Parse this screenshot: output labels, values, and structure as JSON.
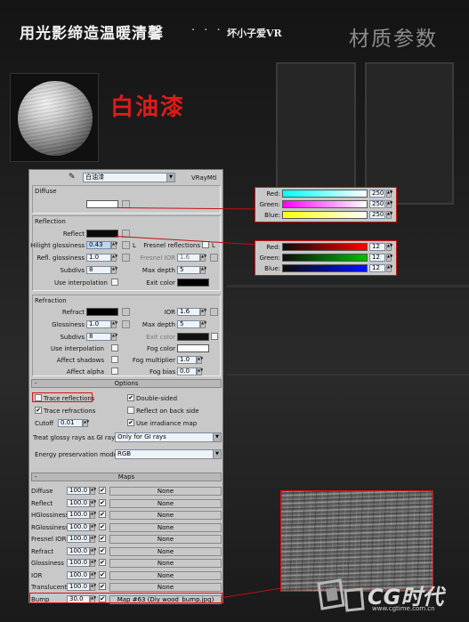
{
  "header": {
    "title": "用光影缔造温暖清馨",
    "dots": "· · ·",
    "author": "坏小子爱VR",
    "section": "材质参数"
  },
  "material_name": "白油漆",
  "panel": {
    "mat_dropdown": "白油漆",
    "mat_type": "VRayMtl",
    "diffuse": {
      "group": "Diffuse",
      "label": "Diffuse",
      "color": "#ffffff"
    },
    "reflection": {
      "group": "Reflection",
      "reflect_label": "Reflect",
      "reflect_color": "#0a0a0a",
      "hilight_label": "Hilight glossiness",
      "hilight_value": "0.43",
      "lock": "L",
      "fresnel_label": "Fresnel reflections",
      "fresnel_lock": "L",
      "refl_gloss_label": "Refl. glossiness",
      "refl_gloss_value": "1.0",
      "fresnel_ior_label": "Fresnel IOR",
      "fresnel_ior_value": "1.6",
      "subdivs_label": "Subdivs",
      "subdivs_value": "8",
      "maxdepth_label": "Max depth",
      "maxdepth_value": "5",
      "use_interp_label": "Use interpolation",
      "exit_label": "Exit color",
      "exit_color": "#000000"
    },
    "refraction": {
      "group": "Refraction",
      "refract_label": "Refract",
      "refract_color": "#000000",
      "ior_label": "IOR",
      "ior_value": "1.6",
      "gloss_label": "Glossiness",
      "gloss_value": "1.0",
      "maxdepth_label": "Max depth",
      "maxdepth_value": "5",
      "subdivs_label": "Subdivs",
      "subdivs_value": "8",
      "exit_label": "Exit color",
      "use_interp_label": "Use interpolation",
      "fog_color_label": "Fog color",
      "fog_color": "#ffffff",
      "affect_shadows_label": "Affect shadows",
      "fog_mult_label": "Fog multiplier",
      "fog_mult_value": "1.0",
      "affect_alpha_label": "Affect alpha",
      "fog_bias_label": "Fog bias",
      "fog_bias_value": "0.0"
    },
    "options": {
      "rollout": "Options",
      "trace_refl": "Trace reflections",
      "double_sided": "Double-sided",
      "trace_refr": "Trace refractions",
      "reflect_back": "Reflect on back side",
      "cutoff_label": "Cutoff",
      "cutoff_value": "0.01",
      "use_irr": "Use irradiance map",
      "glossy_label": "Treat glossy rays as GI rays:",
      "glossy_value": "Only for GI rays",
      "energy_label": "Energy preservation mode:",
      "energy_value": "RGB"
    },
    "maps": {
      "rollout": "Maps",
      "rows": [
        {
          "name": "Diffuse",
          "amount": "100.0",
          "map": "None"
        },
        {
          "name": "Reflect",
          "amount": "100.0",
          "map": "None"
        },
        {
          "name": "HGlossiness",
          "amount": "100.0",
          "map": "None"
        },
        {
          "name": "RGlossiness",
          "amount": "100.0",
          "map": "None"
        },
        {
          "name": "Fresnel IOR",
          "amount": "100.0",
          "map": "None"
        },
        {
          "name": "Refract",
          "amount": "100.0",
          "map": "None"
        },
        {
          "name": "Glossiness",
          "amount": "100.0",
          "map": "None"
        },
        {
          "name": "IOR",
          "amount": "100.0",
          "map": "None"
        },
        {
          "name": "Translucent",
          "amount": "100.0",
          "map": "None"
        },
        {
          "name": "Bump",
          "amount": "30.0",
          "map": "Map #63 (Diy wood_bump.jpg)"
        }
      ]
    }
  },
  "diffuse_picker": {
    "rows": [
      {
        "label": "Red:",
        "value": "250",
        "gradient": "linear-gradient(90deg,#00ffff,#ffffff)"
      },
      {
        "label": "Green:",
        "value": "250",
        "gradient": "linear-gradient(90deg,#ff00ff,#ffffff)"
      },
      {
        "label": "Blue:",
        "value": "250",
        "gradient": "linear-gradient(90deg,#ffff00,#ffffff)"
      }
    ]
  },
  "reflect_picker": {
    "rows": [
      {
        "label": "Red:",
        "value": "12",
        "gradient": "linear-gradient(90deg,#0c0c0c,#ff0000)"
      },
      {
        "label": "Green:",
        "value": "12",
        "gradient": "linear-gradient(90deg,#0c0c0c,#00c000)"
      },
      {
        "label": "Blue:",
        "value": "12",
        "gradient": "linear-gradient(90deg,#0c0c0c,#0010ff)"
      }
    ]
  },
  "logo": {
    "brand": "CG时代",
    "url": "www.cgtime.com.cn"
  }
}
